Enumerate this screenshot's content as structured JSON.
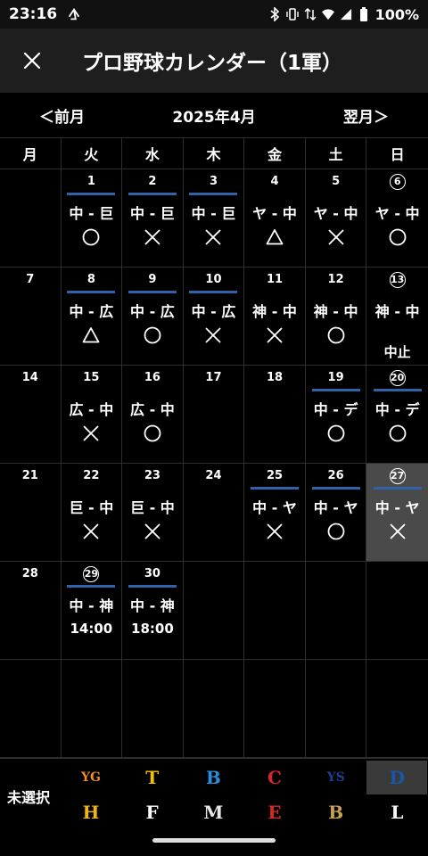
{
  "status": {
    "time": "23:16",
    "battery": "100%"
  },
  "app": {
    "title": "プロ野球カレンダー（1軍）"
  },
  "nav": {
    "prev": "＜前月",
    "current": "2025年4月",
    "next": "翌月＞"
  },
  "weekdays": [
    "月",
    "火",
    "水",
    "木",
    "金",
    "土",
    "日"
  ],
  "weeks": [
    [
      {},
      {
        "day": "1",
        "home": true,
        "matchup": "中 - 巨",
        "result": "win"
      },
      {
        "day": "2",
        "home": true,
        "matchup": "中 - 巨",
        "result": "loss"
      },
      {
        "day": "3",
        "home": true,
        "matchup": "中 - 巨",
        "result": "loss"
      },
      {
        "day": "4",
        "matchup": "ヤ - 中",
        "result": "draw"
      },
      {
        "day": "5",
        "matchup": "ヤ - 中",
        "result": "loss"
      },
      {
        "day": "6",
        "circled": true,
        "matchup": "ヤ - 中",
        "result": "win"
      }
    ],
    [
      {
        "day": "7"
      },
      {
        "day": "8",
        "home": true,
        "matchup": "中 - 広",
        "result": "draw"
      },
      {
        "day": "9",
        "home": true,
        "matchup": "中 - 広",
        "result": "win"
      },
      {
        "day": "10",
        "home": true,
        "matchup": "中 - 広",
        "result": "loss"
      },
      {
        "day": "11",
        "matchup": "神 - 中",
        "result": "loss"
      },
      {
        "day": "12",
        "matchup": "神 - 中",
        "result": "win"
      },
      {
        "day": "13",
        "circled": true,
        "matchup": "神 - 中",
        "note": "中止",
        "noteFar": true
      }
    ],
    [
      {
        "day": "14"
      },
      {
        "day": "15",
        "matchup": "広 - 中",
        "result": "loss"
      },
      {
        "day": "16",
        "matchup": "広 - 中",
        "result": "win"
      },
      {
        "day": "17"
      },
      {
        "day": "18"
      },
      {
        "day": "19",
        "home": true,
        "matchup": "中 - デ",
        "result": "win"
      },
      {
        "day": "20",
        "circled": true,
        "home": true,
        "matchup": "中 - デ",
        "result": "win"
      }
    ],
    [
      {
        "day": "21"
      },
      {
        "day": "22",
        "matchup": "巨 - 中",
        "result": "loss"
      },
      {
        "day": "23",
        "matchup": "巨 - 中",
        "result": "loss"
      },
      {
        "day": "24"
      },
      {
        "day": "25",
        "home": true,
        "matchup": "中 - ヤ",
        "result": "loss"
      },
      {
        "day": "26",
        "home": true,
        "matchup": "中 - ヤ",
        "result": "win"
      },
      {
        "day": "27",
        "circled": true,
        "home": true,
        "selected": true,
        "matchup": "中 - ヤ",
        "result": "loss"
      }
    ],
    [
      {
        "day": "28"
      },
      {
        "day": "29",
        "circled": true,
        "home": true,
        "matchup": "中 - 神",
        "note": "14:00"
      },
      {
        "day": "30",
        "home": true,
        "matchup": "中 - 神",
        "note": "18:00"
      },
      {},
      {},
      {},
      {}
    ],
    [
      {},
      {},
      {},
      {},
      {},
      {},
      {}
    ]
  ],
  "teams": {
    "unselected_label": "未選択",
    "top": [
      {
        "icon": "giants-logo-icon",
        "glyph": "YG",
        "color": "#f08a24"
      },
      {
        "icon": "tigers-logo-icon",
        "glyph": "T",
        "color": "#f2c200"
      },
      {
        "icon": "baystars-logo-icon",
        "glyph": "B",
        "color": "#2a8ee0"
      },
      {
        "icon": "carp-logo-icon",
        "glyph": "C",
        "color": "#d9232e"
      },
      {
        "icon": "swallows-logo-icon",
        "glyph": "YS",
        "color": "#1d3f8f"
      },
      {
        "icon": "dragons-logo-icon",
        "glyph": "D",
        "color": "#1657a8",
        "active": true
      }
    ],
    "bottom": [
      {
        "icon": "hawks-logo-icon",
        "glyph": "H",
        "color": "#f3b800"
      },
      {
        "icon": "fighters-logo-icon",
        "glyph": "F",
        "color": "#ffffff"
      },
      {
        "icon": "marines-logo-icon",
        "glyph": "M",
        "color": "#e8e8e8"
      },
      {
        "icon": "eagles-logo-icon",
        "glyph": "E",
        "color": "#d92b1a"
      },
      {
        "icon": "buffaloes-logo-icon",
        "glyph": "B",
        "color": "#c9a34a"
      },
      {
        "icon": "lions-logo-icon",
        "glyph": "L",
        "color": "#ffffff"
      }
    ]
  }
}
